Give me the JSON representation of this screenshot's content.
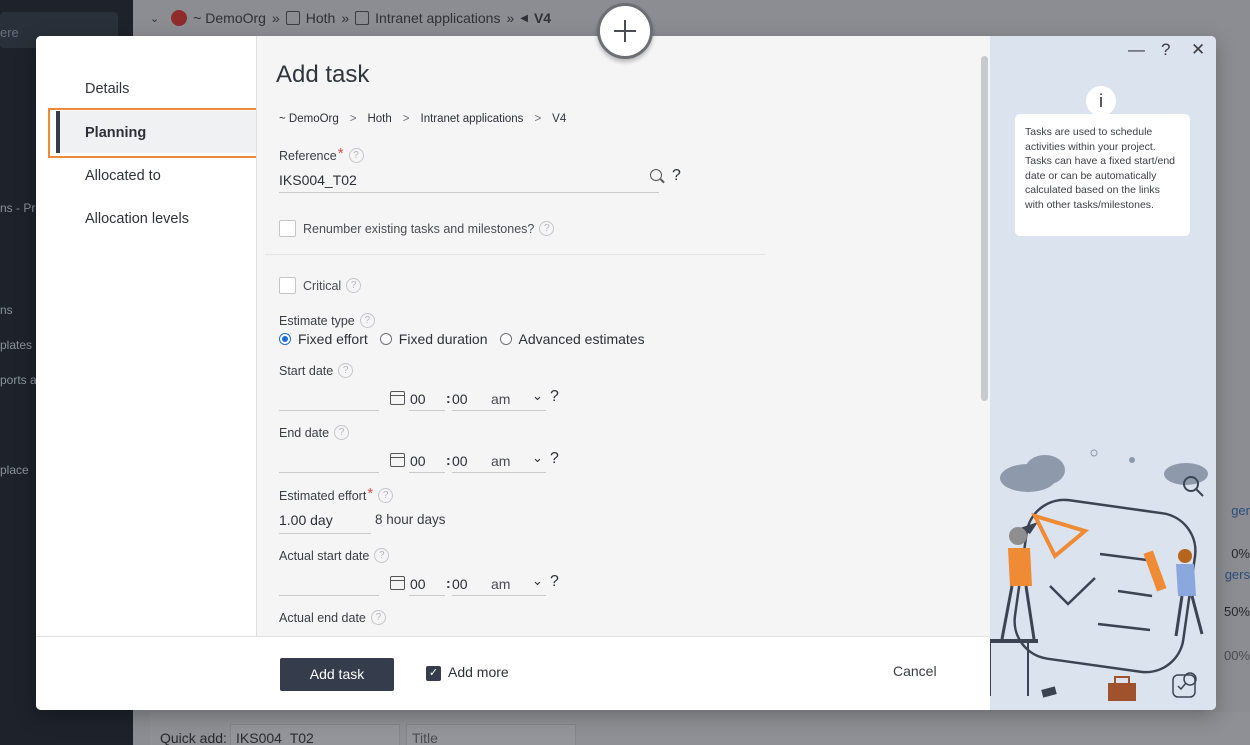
{
  "background": {
    "search_placeholder": "ere",
    "sidebar_items": [
      "ns - Pro",
      "ns",
      "plates",
      "ports a",
      "place"
    ],
    "breadcrumb": [
      "~ DemoOrg",
      "Hoth",
      "Intranet applications",
      "V4"
    ],
    "breadcrumb_sep": "»",
    "quick_add_label": "Quick add:",
    "quick_add_reference": "IKS004_T02",
    "quick_add_title_placeholder": "Title",
    "right_fragments": [
      "ger",
      "0%",
      "gers",
      "50%",
      "00%"
    ]
  },
  "modal": {
    "nav": {
      "items": [
        "Details",
        "Planning",
        "Allocated to",
        "Allocation levels"
      ],
      "active": "Planning"
    },
    "title": "Add task",
    "breadcrumb": [
      "~ DemoOrg",
      "Hoth",
      "Intranet applications",
      "V4"
    ],
    "breadcrumb_sep": ">",
    "reference": {
      "label": "Reference",
      "value": "IKS004_T02"
    },
    "renumber_label": "Renumber existing tasks and milestones?",
    "critical_label": "Critical",
    "estimate_type": {
      "label": "Estimate type",
      "options": [
        "Fixed effort",
        "Fixed duration",
        "Advanced estimates"
      ],
      "selected": "Fixed effort"
    },
    "start_date": {
      "label": "Start date",
      "hour": "00",
      "minute": "00",
      "ampm": "am"
    },
    "end_date": {
      "label": "End date",
      "hour": "00",
      "minute": "00",
      "ampm": "am"
    },
    "estimated_effort": {
      "label": "Estimated effort",
      "value": "1.00 day",
      "unit_note": "8 hour days"
    },
    "actual_start_date": {
      "label": "Actual start date",
      "hour": "00",
      "minute": "00",
      "ampm": "am"
    },
    "actual_end_date": {
      "label": "Actual end date"
    },
    "help_text": "Tasks are used to schedule activities within your project. Tasks can have a fixed start/end date or can be automatically calculated based on the links with other tasks/milestones.",
    "window_controls": [
      "—",
      "?",
      "✕"
    ],
    "footer": {
      "add_button": "Add task",
      "add_more_label": "Add more",
      "add_more_checked": true,
      "cancel": "Cancel"
    }
  },
  "colors": {
    "accent": "#353c4b",
    "highlight": "#ee8a38",
    "required": "#e24b4b",
    "radio": "#1f6bd6",
    "help_bg": "#dbe3ee"
  }
}
